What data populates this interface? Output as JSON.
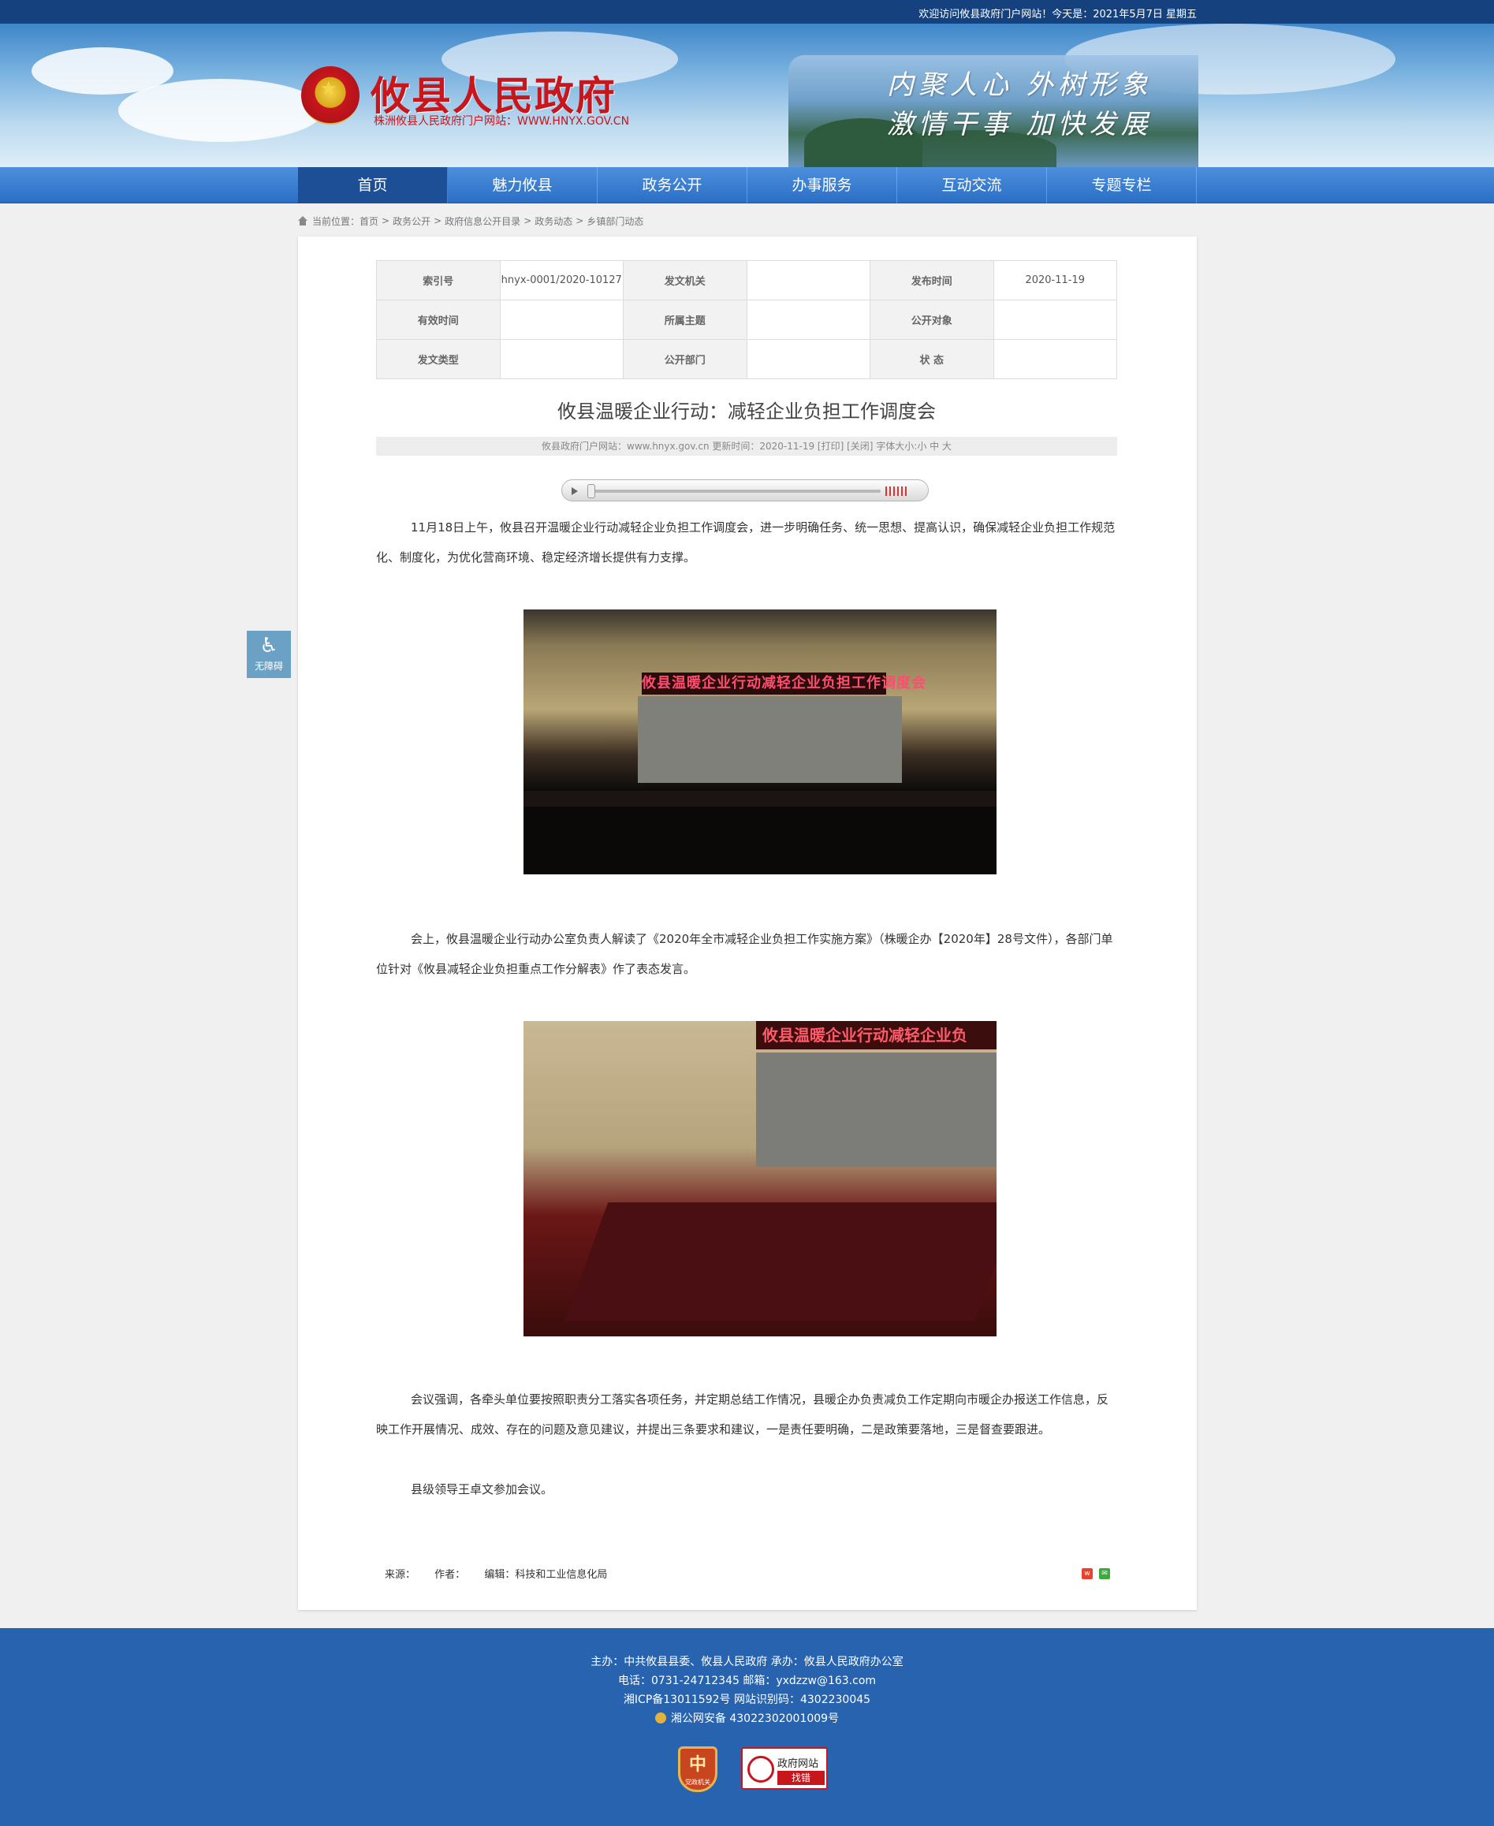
{
  "topbar": {
    "welcome": "欢迎访问攸县政府门户网站！今天是：2021年5月7日 星期五"
  },
  "header": {
    "title": "攸县人民政府",
    "subtitle": "株洲攸县人民政府门户网站：WWW.HNYX.GOV.CN",
    "slogan_line1": "内聚人心  外树形象",
    "slogan_line2": "激情干事  加快发展"
  },
  "nav": {
    "items": [
      "首页",
      "魅力攸县",
      "政务公开",
      "办事服务",
      "互动交流",
      "专题专栏"
    ],
    "active": "首页"
  },
  "breadcrumb": {
    "prefix": "当前位置：",
    "items": [
      "首页",
      "政务公开",
      "政府信息公开目录",
      "政务动态",
      "乡镇部门动态"
    ],
    "separator": ">"
  },
  "meta": {
    "index_label": "索引号",
    "index_value": "hnyx-0001/2020-10127",
    "org_label": "发文机关",
    "org_value": "",
    "date_label": "发布时间",
    "date_value": "2020-11-19",
    "valid_label": "有效时间",
    "valid_value": "",
    "topic_label": "所属主题",
    "topic_value": "",
    "audience_label": "公开对象",
    "audience_value": "",
    "type_label": "发文类型",
    "type_value": "",
    "dept_label": "公开部门",
    "dept_value": "",
    "status_label": "状 态",
    "status_value": ""
  },
  "article": {
    "title": "攸县温暖企业行动：减轻企业负担工作调度会",
    "info": "攸县政府门户网站：www.hnyx.gov.cn   更新时间：2020-11-19  [打印] [关闭]  字体大小:小 中 大",
    "p1": "11月18日上午，攸县召开温暖企业行动减轻企业负担工作调度会，进一步明确任务、统一思想、提高认识，确保减轻企业负担工作规范化、制度化，为优化营商环境、稳定经济增长提供有力支撑。",
    "photo1_banner": "攸县温暖企业行动减轻企业负担工作调度会",
    "p2": "会上，攸县温暖企业行动办公室负责人解读了《2020年全市减轻企业负担工作实施方案》（株暖企办【2020年】28号文件），各部门单位针对《攸县减轻企业负担重点工作分解表》作了表态发言。",
    "photo2_banner": "攸县温暖企业行动减轻企业负",
    "p3": "会议强调，各牵头单位要按照职责分工落实各项任务，并定期总结工作情况，县暖企办负责减负工作定期向市暖企办报送工作信息，反映工作开展情况、成效、存在的问题及意见建议，并提出三条要求和建议，一是责任要明确，二是政策要落地，三是督查要跟进。",
    "p4": "县级领导王卓文参加会议。",
    "source": "来源：",
    "author": "作者：",
    "editor": "编辑：科技和工业信息化局"
  },
  "accessibility": {
    "label": "无障碍",
    "icon": "wheelchair-icon"
  },
  "footer": {
    "line1": "主办：中共攸县县委、攸县人民政府 承办：攸县人民政府办公室",
    "line2": "电话：0731-24712345  邮箱：yxdzzw@163.com",
    "line3": "湘ICP备13011592号    网站识别码：4302230045",
    "line4": "湘公网安备 43022302001009号",
    "badge1": "党政机关",
    "badge2_line1": "政府网站",
    "badge2_line2": "找错"
  },
  "colors": {
    "nav": "#2b6fc6",
    "nav_active": "#1c4f95",
    "footer": "#2763ae",
    "title_red": "#c8161d"
  }
}
